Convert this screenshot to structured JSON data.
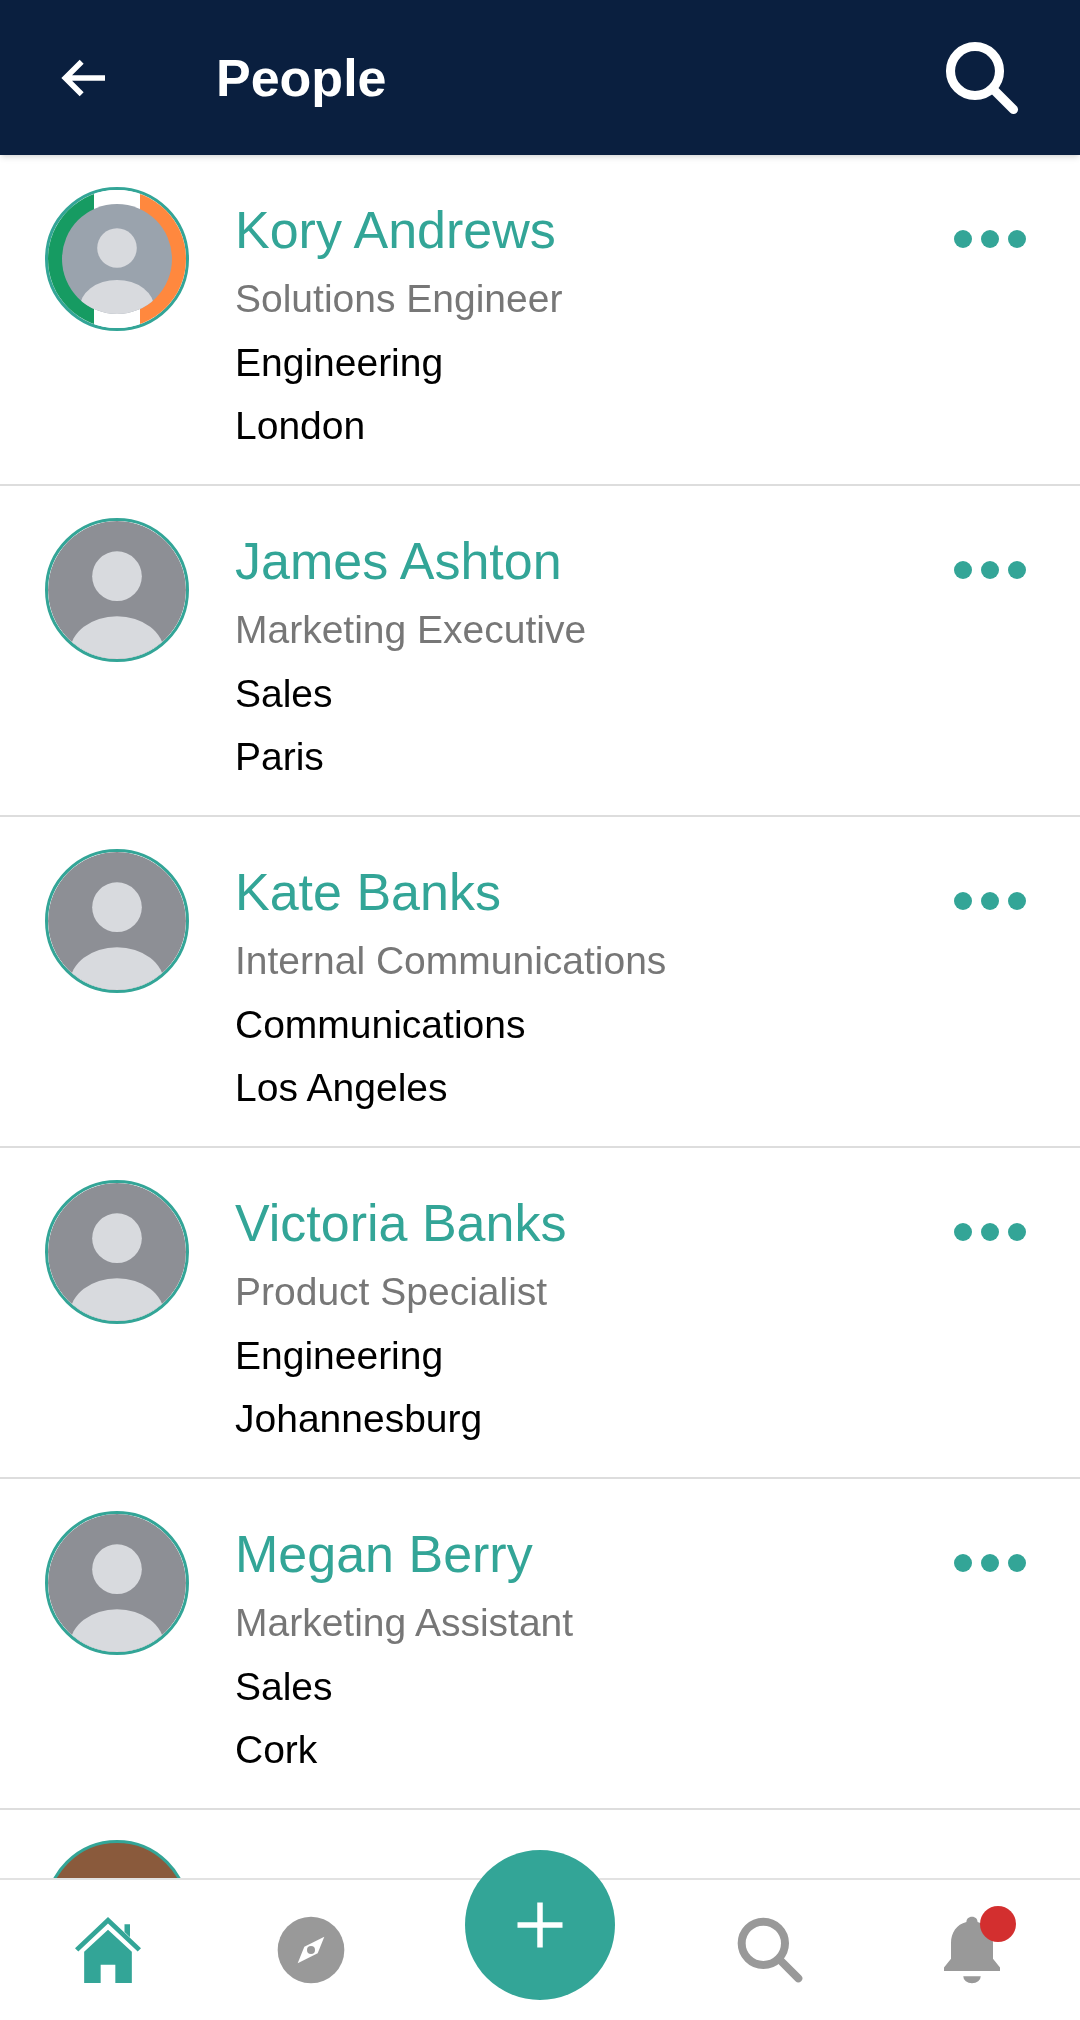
{
  "header": {
    "title": "People"
  },
  "people": [
    {
      "name": "Kory Andrews",
      "role": "Solutions Engineer",
      "department": "Engineering",
      "location": "London",
      "flag_border": true
    },
    {
      "name": "James Ashton",
      "role": "Marketing Executive",
      "department": "Sales",
      "location": "Paris",
      "flag_border": false
    },
    {
      "name": "Kate Banks",
      "role": "Internal Communications",
      "department": "Communications",
      "location": "Los Angeles",
      "flag_border": false
    },
    {
      "name": "Victoria Banks",
      "role": "Product Specialist",
      "department": "Engineering",
      "location": "Johannesburg",
      "flag_border": false
    },
    {
      "name": "Megan Berry",
      "role": "Marketing Assistant",
      "department": "Sales",
      "location": "Cork",
      "flag_border": false
    }
  ],
  "bottom_nav": [
    {
      "kind": "home",
      "selected": true
    },
    {
      "kind": "explore",
      "selected": false
    },
    {
      "kind": "add",
      "selected": false
    },
    {
      "kind": "search",
      "selected": false
    },
    {
      "kind": "notifications",
      "selected": false,
      "badge": true
    }
  ]
}
